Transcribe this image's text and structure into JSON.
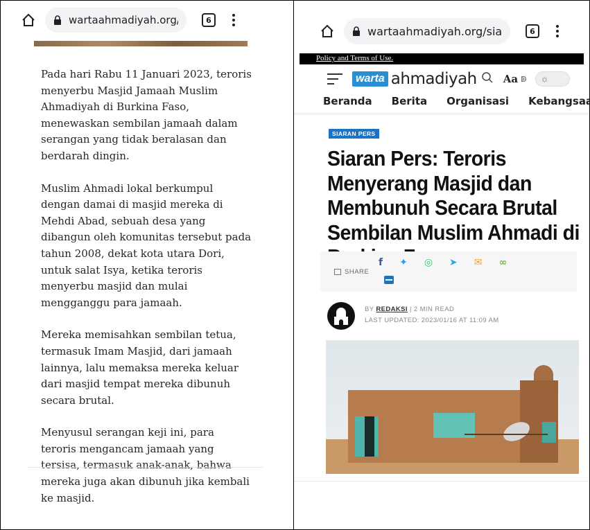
{
  "left": {
    "browser": {
      "url": "wartaahmadiyah.org/sia",
      "tab_count": "6"
    },
    "paragraphs": [
      "Pada hari Rabu 11 Januari 2023, teroris menyerbu Masjid Jamaah Muslim Ahmadiyah di Burkina Faso, menewaskan sembilan jamaah dalam serangan yang tidak beralasan dan berdarah dingin.",
      "Muslim Ahmadi lokal berkumpul dengan damai di masjid mereka di Mehdi Abad, sebuah desa yang dibangun oleh komunitas tersebut pada tahun 2008, dekat kota utara Dori, untuk salat Isya, ketika teroris menyerbu masjid dan mulai mengganggu para jamaah.",
      "Mereka memisahkan sembilan tetua, termasuk Imam Masjid, dari jamaah lainnya, lalu memaksa mereka keluar dari masjid tempat mereka dibunuh secara brutal.",
      "Menyusul serangan keji ini, para teroris mengancam jamaah yang tersisa, termasuk anak-anak, bahwa mereka juga akan dibunuh jika kembali ke masjid."
    ]
  },
  "right": {
    "browser": {
      "url": "wartaahmadiyah.org/sia",
      "tab_count": "6"
    },
    "policy_text": "Policy and Terms of Use.",
    "logo": {
      "box": "warta",
      "text": "ahmadiyah"
    },
    "font_size_label": "Aa",
    "nav": [
      "Beranda",
      "Berita",
      "Organisasi",
      "Kebangsaan"
    ],
    "badge": "SIARAN PERS",
    "title": "Siaran Pers: Teroris Menyerang Masjid dan Membunuh Secara Brutal Sembilan Muslim Ahmadi di Burkina Faso",
    "share_label": "SHARE",
    "share_icons": [
      {
        "name": "facebook-icon",
        "glyph": "f",
        "color": "#3b5998"
      },
      {
        "name": "twitter-icon",
        "glyph": "✦",
        "color": "#1da1f2"
      },
      {
        "name": "whatsapp-icon",
        "glyph": "◎",
        "color": "#25d366"
      },
      {
        "name": "telegram-icon",
        "glyph": "➤",
        "color": "#2ca5e0"
      },
      {
        "name": "email-icon",
        "glyph": "✉",
        "color": "#f0a030"
      },
      {
        "name": "link-icon",
        "glyph": "∞",
        "color": "#74b74a"
      }
    ],
    "meta": {
      "by_prefix": "BY",
      "author": "REDAKSI",
      "read_time": "| 2 MIN READ",
      "updated": "LAST UPDATED: 2023/01/16 AT 11:09 AM"
    },
    "colors": {
      "brand": "#2a8fd0",
      "badge": "#1a73c4"
    }
  }
}
